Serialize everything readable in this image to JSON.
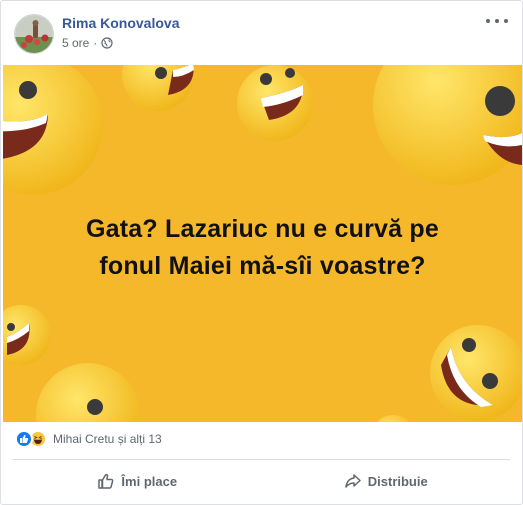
{
  "post": {
    "author": "Rima Konovalova",
    "time": "5 ore",
    "separator": "·",
    "privacy_icon": "globe-icon",
    "more_icon": "more-options-icon"
  },
  "banner": {
    "line1": "Gata? Lazariuc nu e curvă pe",
    "line2": "fonul Maiei mă-sîi voastre?",
    "background_color": "#f6b82b"
  },
  "reactions": {
    "icons": [
      "like-reaction-icon",
      "haha-reaction-icon"
    ],
    "summary": "Mihai Cretu și alți 13"
  },
  "actions": {
    "like_label": "Îmi place",
    "share_label": "Distribuie"
  },
  "colors": {
    "link": "#385898",
    "muted": "#606770",
    "like_blue": "#1877f2"
  }
}
